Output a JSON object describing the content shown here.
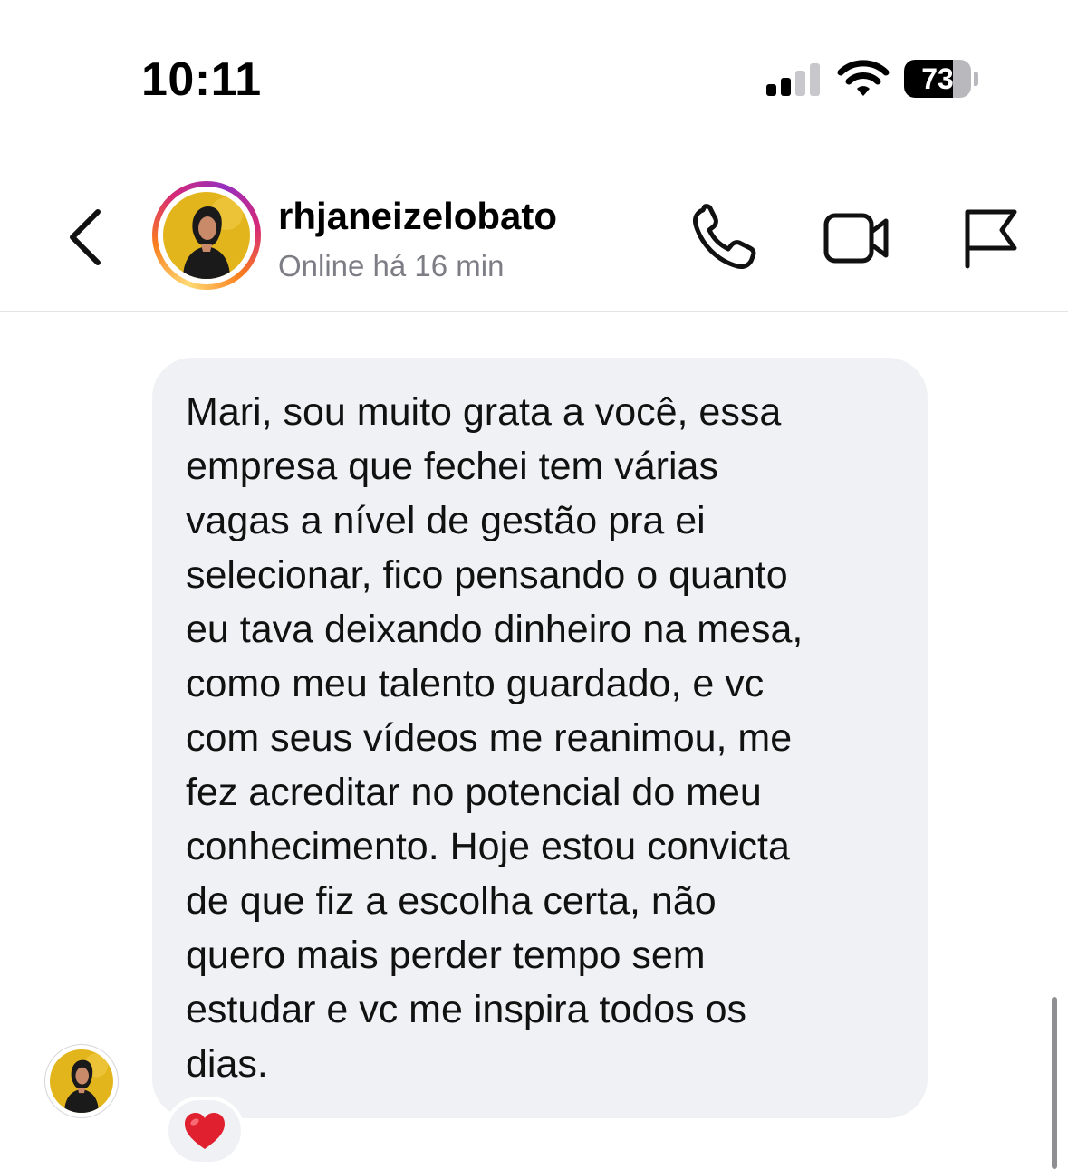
{
  "status_bar": {
    "time": "10:11",
    "battery_level": "73",
    "battery_fraction": 0.73,
    "signal_bars_active": 2,
    "signal_bars_total": 4
  },
  "header": {
    "username": "rhjaneizelobato",
    "presence": "Online há 16 min"
  },
  "message": {
    "text": "Mari, sou muito grata a  você,  essa\nempresa que fechei tem várias\nvagas a nível de gestão pra ei\nselecionar,  fico pensando o quanto\neu tava deixando dinheiro na mesa,\ncomo meu talento guardado,  e vc\ncom seus vídeos me reanimou,  me\nfez acreditar no potencial do meu\nconhecimento. Hoje estou convicta\nde que fiz a escolha certa,  não\nquero mais perder tempo sem\nestudar e vc me inspira todos os\ndias.",
    "reaction": "heart-icon"
  },
  "colors": {
    "bubble_bg": "#f0f1f4",
    "presence_text": "#7d7d85",
    "avatar_bg": "#e3b51d",
    "heart": "#e0202f"
  }
}
